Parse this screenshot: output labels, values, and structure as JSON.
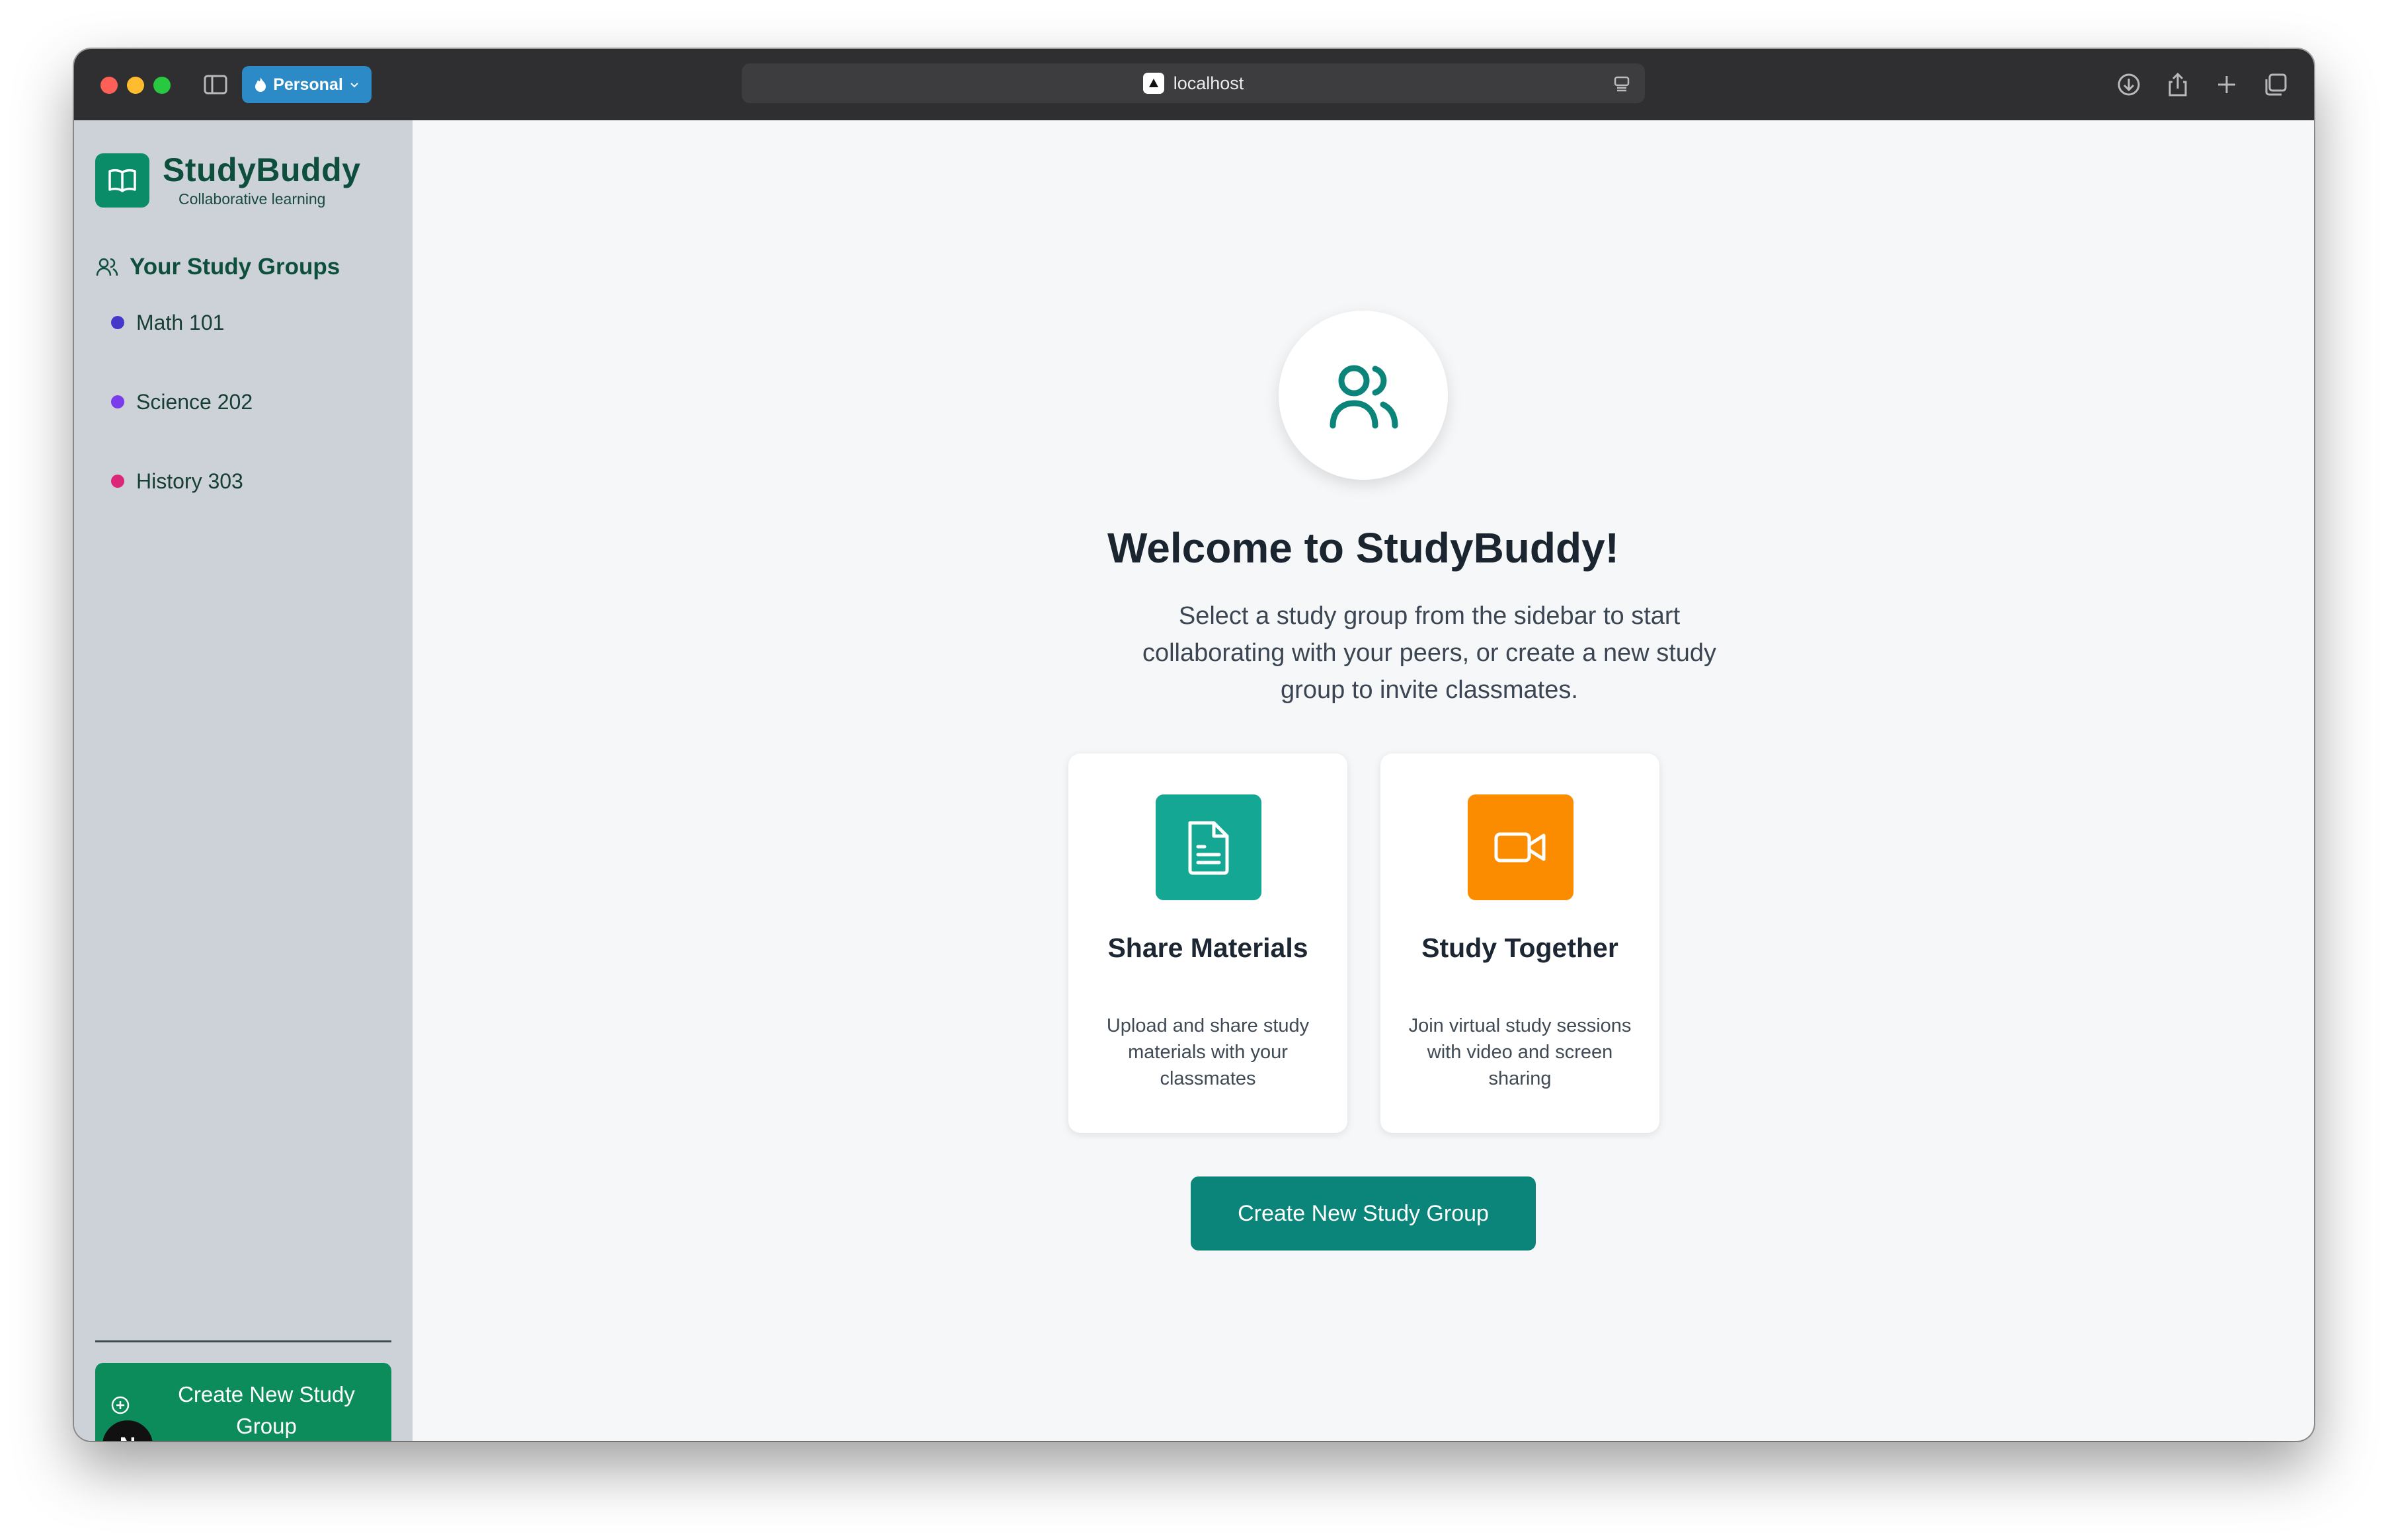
{
  "browser": {
    "profile_label": "Personal",
    "url": "localhost"
  },
  "sidebar": {
    "brand_name": "StudyBuddy",
    "brand_tagline": "Collaborative learning",
    "groups_heading": "Your Study Groups",
    "groups": [
      {
        "label": "Math 101",
        "color": "#4338ca"
      },
      {
        "label": "Science 202",
        "color": "#7c3aed"
      },
      {
        "label": "History 303",
        "color": "#db2777"
      }
    ],
    "create_button_label": "Create New Study Group",
    "nextjs_badge": "N"
  },
  "main": {
    "title": "Welcome to StudyBuddy!",
    "description": "Select a study group from the sidebar to start collaborating with your peers, or create a new study group to invite classmates.",
    "features": [
      {
        "title": "Share Materials",
        "description": "Upload and share study materials with your classmates",
        "icon": "document-icon",
        "color": "#14a894"
      },
      {
        "title": "Study Together",
        "description": "Join virtual study sessions with video and screen sharing",
        "icon": "video-camera-icon",
        "color": "#fb8c00"
      }
    ],
    "create_button_label": "Create New Study Group"
  },
  "colors": {
    "accent": "#0b847a",
    "sidebar_accent": "#0b8c5a",
    "sidebar_bg": "#cdd2d8"
  }
}
